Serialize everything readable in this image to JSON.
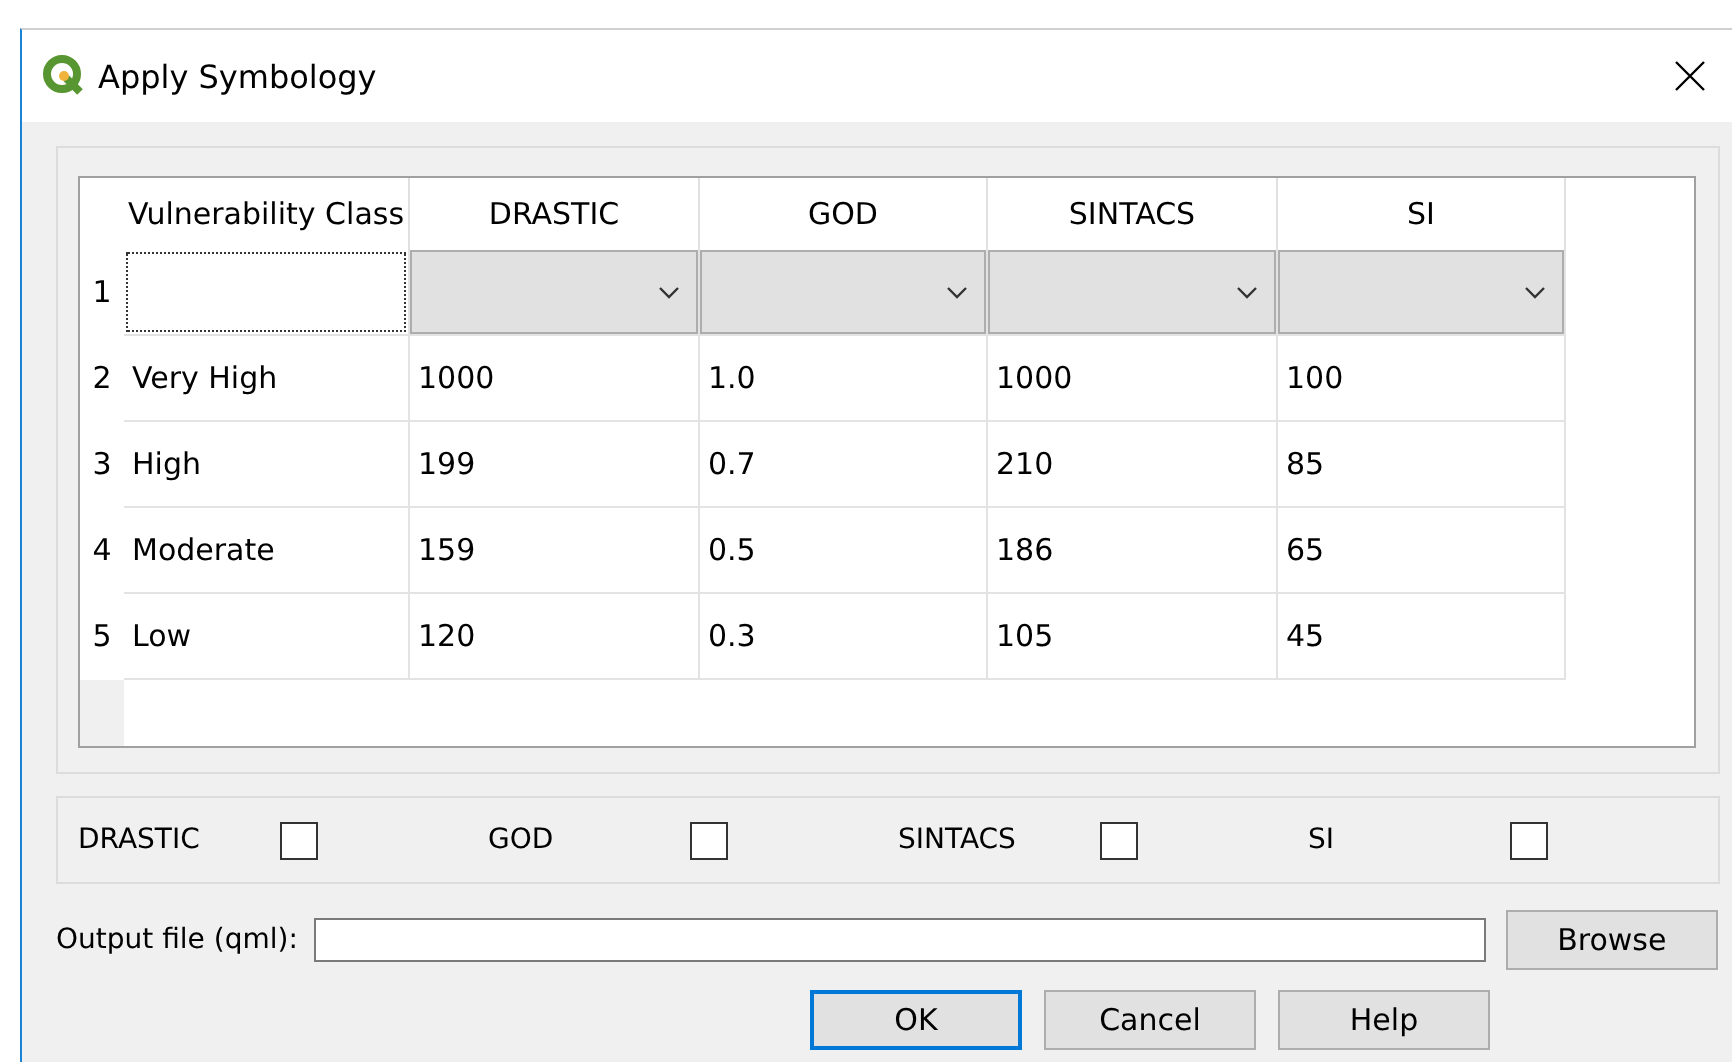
{
  "window": {
    "title": "Apply Symbology"
  },
  "table": {
    "columns": [
      "Vulnerability Class",
      "DRASTIC",
      "GOD",
      "SINTACS",
      "SI"
    ],
    "rows": [
      {
        "header": "1",
        "cells": [
          {
            "kind": "input"
          },
          {
            "kind": "combo"
          },
          {
            "kind": "combo"
          },
          {
            "kind": "combo"
          },
          {
            "kind": "combo"
          }
        ]
      },
      {
        "header": "2",
        "cells": [
          {
            "kind": "text",
            "text": "Very High"
          },
          {
            "kind": "text",
            "text": "1000"
          },
          {
            "kind": "text",
            "text": "1.0"
          },
          {
            "kind": "text",
            "text": "1000"
          },
          {
            "kind": "text",
            "text": "100"
          }
        ]
      },
      {
        "header": "3",
        "cells": [
          {
            "kind": "text",
            "text": "High"
          },
          {
            "kind": "text",
            "text": "199"
          },
          {
            "kind": "text",
            "text": "0.7"
          },
          {
            "kind": "text",
            "text": "210"
          },
          {
            "kind": "text",
            "text": "85"
          }
        ]
      },
      {
        "header": "4",
        "cells": [
          {
            "kind": "text",
            "text": "Moderate"
          },
          {
            "kind": "text",
            "text": "159"
          },
          {
            "kind": "text",
            "text": "0.5"
          },
          {
            "kind": "text",
            "text": "186"
          },
          {
            "kind": "text",
            "text": "65"
          }
        ]
      },
      {
        "header": "5",
        "cells": [
          {
            "kind": "text",
            "text": "Low"
          },
          {
            "kind": "text",
            "text": "120"
          },
          {
            "kind": "text",
            "text": "0.3"
          },
          {
            "kind": "text",
            "text": "105"
          },
          {
            "kind": "text",
            "text": "45"
          }
        ]
      }
    ]
  },
  "checkboxes": [
    {
      "label": "DRASTIC",
      "checked": false
    },
    {
      "label": "GOD",
      "checked": false
    },
    {
      "label": "SINTACS",
      "checked": false
    },
    {
      "label": "SI",
      "checked": false
    }
  ],
  "output": {
    "label": "Output file (qml):",
    "browse": "Browse"
  },
  "buttons": [
    {
      "label": "OK",
      "default": true
    },
    {
      "label": "Cancel",
      "default": false
    },
    {
      "label": "Help",
      "default": false
    }
  ]
}
